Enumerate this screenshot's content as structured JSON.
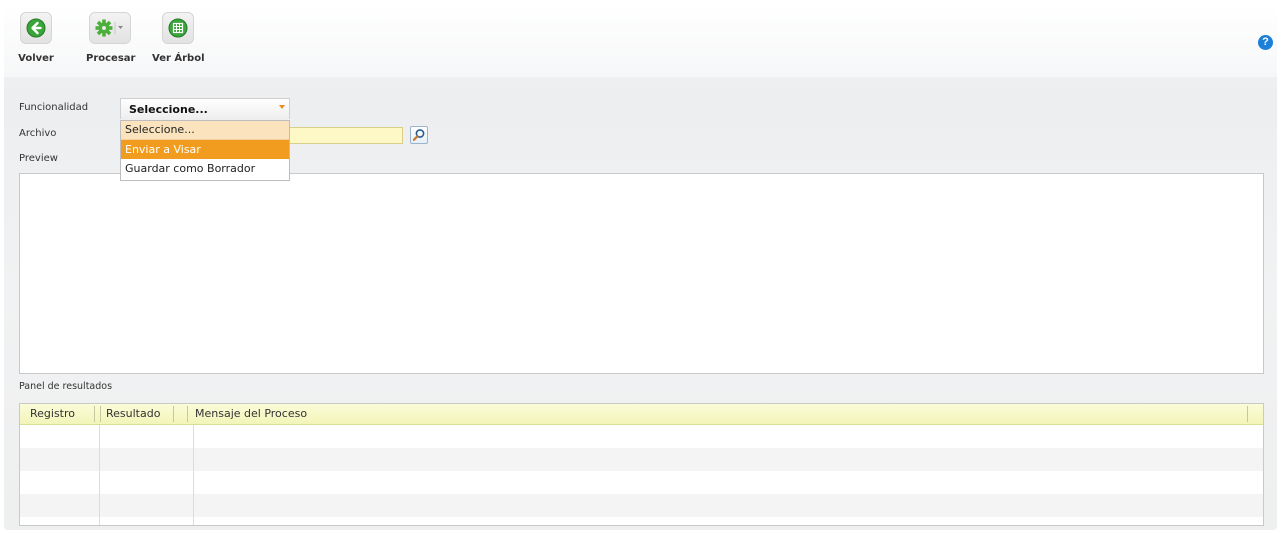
{
  "toolbar": {
    "volver": {
      "label": "Volver",
      "icon": "back-arrow-icon"
    },
    "procesar": {
      "label": "Procesar",
      "icon": "gear-icon"
    },
    "ver_arbol": {
      "label": "Ver Árbol",
      "icon": "tree-grid-icon"
    }
  },
  "help": {
    "glyph": "?",
    "icon": "help-icon"
  },
  "form": {
    "funcionalidad_label": "Funcionalidad",
    "funcionalidad_value": "Seleccione...",
    "funcionalidad_options": [
      "Seleccione...",
      "Enviar a Visar",
      "Guardar como Borrador"
    ],
    "archivo_label": "Archivo",
    "archivo_value": "",
    "preview_label": "Preview"
  },
  "results": {
    "panel_label": "Panel de resultados",
    "columns": [
      "Registro",
      "Resultado",
      "Mensaje del Proceso"
    ]
  },
  "colors": {
    "accent_orange": "#f29c1f",
    "input_yellow": "#fdf8c5",
    "header_yellow": "#f2f5b8",
    "help_blue": "#1e7fd8"
  }
}
